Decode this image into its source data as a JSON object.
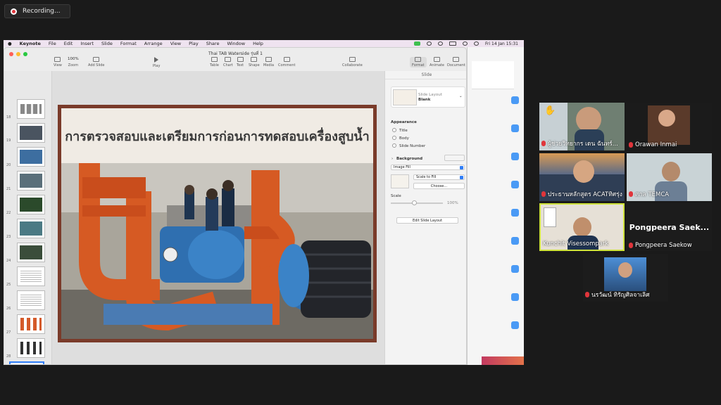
{
  "recording": {
    "label": "Recording..."
  },
  "menubar": {
    "app": "Keynote",
    "items": [
      "File",
      "Edit",
      "Insert",
      "Slide",
      "Format",
      "Arrange",
      "View",
      "Play",
      "Share",
      "Window",
      "Help"
    ],
    "clock": "Fri 14 Jan  15:31"
  },
  "keynote": {
    "doc_title": "Thai TAB Waterside รุ่นที่ 1",
    "toolbar": {
      "view": "View",
      "zoom_value": "100%",
      "zoom": "Zoom",
      "add_slide": "Add Slide",
      "play": "Play",
      "table": "Table",
      "chart": "Chart",
      "text": "Text",
      "shape": "Shape",
      "media": "Media",
      "comment": "Comment",
      "collaborate": "Collaborate",
      "format": "Format",
      "animate": "Animate",
      "document": "Document"
    },
    "slide_numbers": [
      "18",
      "19",
      "20",
      "21",
      "22",
      "23",
      "24",
      "25",
      "26",
      "27",
      "28",
      "29"
    ],
    "slide": {
      "title": "การตรวจสอบและเตรียมการก่อนการทดสอบเครื่องสูบน้ำ"
    },
    "inspector": {
      "tab": "Slide",
      "layout_label": "Slide Layout",
      "layout_value": "Blank",
      "appearance": "Appearance",
      "opt_title": "Title",
      "opt_body": "Body",
      "opt_number": "Slide Number",
      "background": "Background",
      "fill_type": "Image Fill",
      "scale_mode": "Scale to Fill",
      "choose": "Choose...",
      "scale": "Scale",
      "scale_value": "100%",
      "edit_layout": "Edit Slide Layout"
    }
  },
  "participants": [
    {
      "name": "ผู้ช่วยวิทยากร เดน ฉันทร์...",
      "muted": true,
      "hand_raised": true
    },
    {
      "name": "Orawan Inmai",
      "muted": true
    },
    {
      "name": "ประธานหลักสูตร ACATทิศรุ่ง",
      "muted": true
    },
    {
      "name": "ศกล TEMCA",
      "muted": true
    },
    {
      "name": "Kunchit Visessompark",
      "muted": false,
      "active_speaker": true
    },
    {
      "name": "Pongpeera Saekow",
      "muted": true,
      "display_name": "Pongpeera  Saek..."
    },
    {
      "name": "นรวัฒน์ ทิรัญศิลจาเลิศ",
      "muted": true
    }
  ]
}
